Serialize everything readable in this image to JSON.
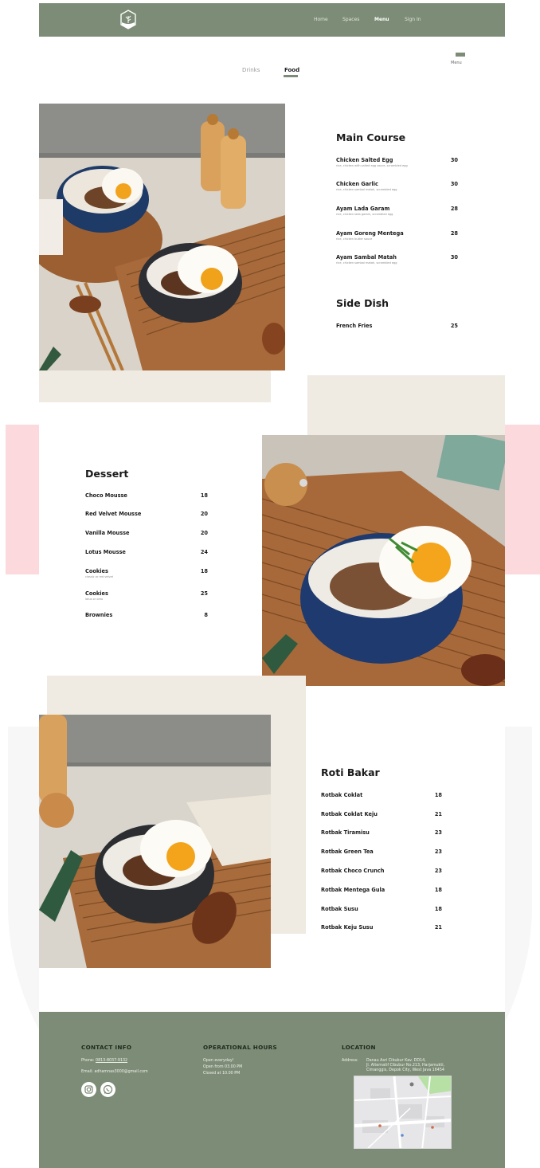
{
  "nav": {
    "links": [
      "Home",
      "Spaces",
      "Menu",
      "Sign In"
    ],
    "active": "Menu"
  },
  "tabs": {
    "drinks": "Drinks",
    "food": "Food"
  },
  "menu_button": {
    "label": "Menu"
  },
  "main_course": {
    "title": "Main Course",
    "items": [
      {
        "name": "Chicken Salted Egg",
        "desc": "rice, chicken with salted egg sauce, scrambled egg",
        "price": "30"
      },
      {
        "name": "Chicken Garlic",
        "desc": "rice, chicken sambal matah, scrambled egg",
        "price": "30"
      },
      {
        "name": "Ayam Lada Garam",
        "desc": "rice, chicken lada garam, scrambled egg",
        "price": "28"
      },
      {
        "name": "Ayam Goreng Mentega",
        "desc": "rice, chicken butter sauce",
        "price": "28"
      },
      {
        "name": "Ayam Sambal Matah",
        "desc": "rice, chicken sambal matah, scrambled egg",
        "price": "30"
      }
    ]
  },
  "side_dish": {
    "title": "Side Dish",
    "items": [
      {
        "name": "French Fries",
        "price": "25"
      }
    ]
  },
  "dessert": {
    "title": "Dessert",
    "items": [
      {
        "name": "Choco Mousse",
        "desc": "",
        "price": "18"
      },
      {
        "name": "Red Velvet Mousse",
        "desc": "",
        "price": "20"
      },
      {
        "name": "Vanilla Mousse",
        "desc": "",
        "price": "20"
      },
      {
        "name": "Lotus Mousse",
        "desc": "",
        "price": "24"
      },
      {
        "name": "Cookies",
        "desc": "classic or red velvet",
        "price": "18"
      },
      {
        "name": "Cookies",
        "desc": "lotus or oreo",
        "price": "25"
      },
      {
        "name": "Brownies",
        "desc": "",
        "price": "8"
      }
    ]
  },
  "roti_bakar": {
    "title": "Roti Bakar",
    "items": [
      {
        "name": "Rotbak Coklat",
        "price": "18"
      },
      {
        "name": "Rotbak Coklat Keju",
        "price": "21"
      },
      {
        "name": "Rotbak Tiramisu",
        "price": "23"
      },
      {
        "name": "Rotbak Green Tea",
        "price": "23"
      },
      {
        "name": "Rotbak Choco Crunch",
        "price": "23"
      },
      {
        "name": "Rotbak Mentega Gula",
        "price": "18"
      },
      {
        "name": "Rotbak Susu",
        "price": "18"
      },
      {
        "name": "Rotbak Keju Susu",
        "price": "21"
      }
    ]
  },
  "footer": {
    "contact": {
      "title": "CONTACT INFO",
      "phone_label": "Phone:",
      "phone": "0813-8037-9132",
      "email_label": "Email:",
      "email": "adhamnas3000@gmail.com"
    },
    "hours": {
      "title": "OPERATIONAL HOURS",
      "lines": [
        "Open everyday!",
        "Open from 03.00 PM",
        "Closed at 10.00 PM"
      ]
    },
    "location": {
      "title": "LOCATION",
      "address_label": "Address:",
      "address_lines": [
        "Danau Asri Cibubur Kav. DD14,",
        "Jl. Alternatif Cibubur No.213, Harjamukti,",
        "Cimanggis, Depok City, West Java 16454"
      ]
    },
    "social_icons": [
      "instagram-icon",
      "whatsapp-icon"
    ]
  },
  "colors": {
    "sage": "#7d8c76",
    "beige": "#efebe2",
    "pink": "#fbd9dc"
  }
}
